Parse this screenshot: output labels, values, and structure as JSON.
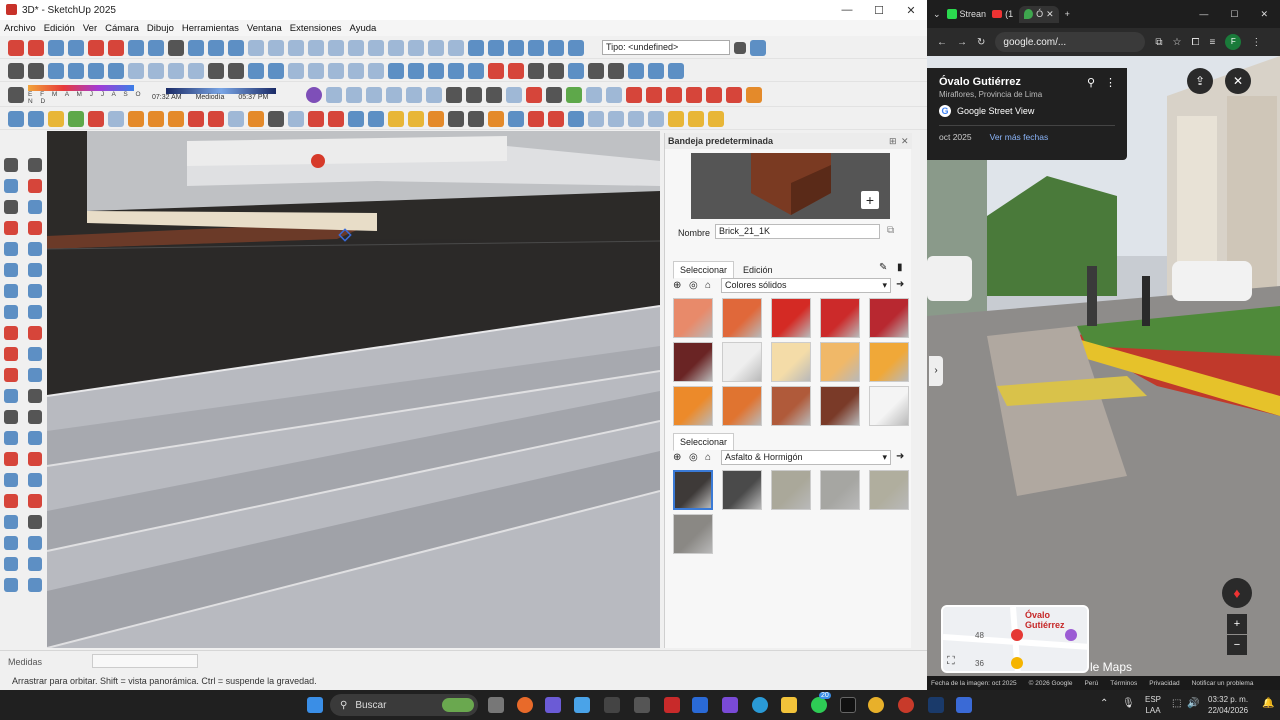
{
  "sketchup": {
    "title": "3D* - SketchUp 2025",
    "window_controls": [
      "—",
      "☐",
      "✕"
    ],
    "menu": [
      "Archivo",
      "Edición",
      "Ver",
      "Cámara",
      "Dibujo",
      "Herramientas",
      "Ventana",
      "Extensiones",
      "Ayuda"
    ],
    "type_field": "Tipo: <undefined>",
    "shadow_bar": {
      "months": "E F M A M J J A S O N D",
      "time_start": "07:32 AM",
      "time_mid": "Mediodía",
      "time_end": "05:37 PM"
    },
    "tray": {
      "header": "Bandeja predeterminada",
      "name_label": "Nombre",
      "name_value": "Brick_21_1K",
      "tab_select": "Seleccionar",
      "tab_edit": "Edición",
      "collection1": "Colores sólidos",
      "second_select": "Seleccionar",
      "collection2": "Asfalto & Hormigón",
      "solid_colors": [
        "#e88a6a",
        "#e0683a",
        "#d42a24",
        "#cc2a2a",
        "#b82830",
        "#6a2424",
        "#eeeeee",
        "#f4dca8",
        "#f0b868",
        "#f0a838",
        "#ec8a2a",
        "#e07430",
        "#b05a3a",
        "#7a3a28",
        "#f4f4f4"
      ],
      "asphalt_colors": [
        "#3e3a38",
        "#4a4a4a",
        "#aaa89a",
        "#a6a6a2",
        "#b0ae9e",
        "#8a8884"
      ]
    },
    "status": {
      "measures_label": "Medidas",
      "hint": "Arrastrar para orbitar. Shift = vista panorámica. Ctrl = suspende la gravedad."
    }
  },
  "chrome": {
    "tabs": [
      "Strean",
      "(1",
      "Ó"
    ],
    "url": "google.com/...",
    "profile": "F",
    "place": {
      "name": "Óvalo Gutiérrez",
      "region": "Miraflores, Provincia de Lima",
      "badge": "Google Street View",
      "date": "oct 2025",
      "more_dates": "Ver más fechas"
    },
    "minimap_label": "Óvalo Gutiérrez",
    "minimap_numbers": [
      "48",
      "36"
    ],
    "maps_text": "le Maps",
    "footer": [
      "Fecha de la imagen: oct 2025",
      "© 2026 Google",
      "Perú",
      "Términos",
      "Privacidad",
      "Notificar un problema"
    ]
  },
  "taskbar": {
    "search": "Buscar",
    "lang": "ESP",
    "lang2": "LAA",
    "time": "03:32 p. m.",
    "date": "22/04/2026",
    "badge": "20"
  }
}
